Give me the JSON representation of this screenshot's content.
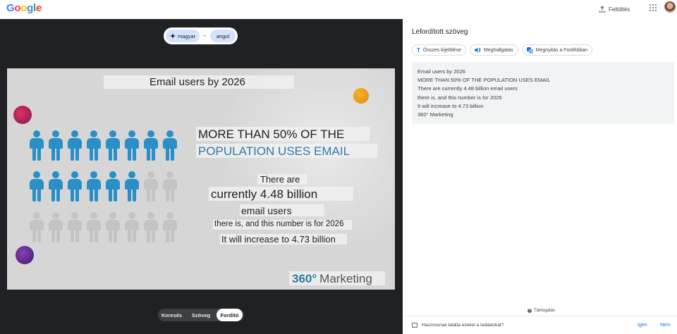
{
  "header": {
    "logo_letters": [
      {
        "char": "G",
        "color": "#4285F4"
      },
      {
        "char": "o",
        "color": "#EA4335"
      },
      {
        "char": "o",
        "color": "#FBBC05"
      },
      {
        "char": "g",
        "color": "#4285F4"
      },
      {
        "char": "l",
        "color": "#34A853"
      },
      {
        "char": "e",
        "color": "#EA4335"
      }
    ],
    "upload_label": "Feltöltés",
    "upload_icon": "upload-icon",
    "apps_icon": "apps-grid-icon"
  },
  "language_bar": {
    "source": "magyar",
    "target": "angol",
    "arrow": "→"
  },
  "image_overlays": {
    "title": "Email users by 2026",
    "headline_1": "MORE THAN 50% OF THE",
    "headline_2": "POPULATION USES EMAIL",
    "line_1": "There are",
    "line_2": "currently 4.48 billion",
    "line_3": "email users",
    "line_4": "there is, and this number is for 2026",
    "line_5": "It will increase to 4.73 billion",
    "brand_number": "360°",
    "brand_name": "Marketing"
  },
  "infographic": {
    "rows": 3,
    "columns": 8,
    "filled_count": 14,
    "filled_color": "#2a8fc7",
    "empty_color": "#c4c4c4"
  },
  "mode_switcher": {
    "items": [
      "Keresés",
      "Szöveg",
      "Fordító"
    ],
    "active": "Fordító"
  },
  "translation_panel": {
    "title": "Lefordított szöveg",
    "actions": [
      {
        "label": "Összes kijelölése",
        "icon": "select-text-icon"
      },
      {
        "label": "Meghallgatás",
        "icon": "speaker-icon"
      },
      {
        "label": "Megnyitás a Fordítóban",
        "icon": "translate-icon"
      }
    ],
    "result_lines": [
      "Email users by 2026",
      "MORE THAN 50% OF THE POPULATION USES EMAIL",
      "There are currently 4.48 billion email users",
      "there is, and this number is for 2026",
      "It will increase to 4.73 billion",
      "360° Marketing"
    ],
    "support_label": "Támogatás",
    "feedback_question": "Hasznosnak találta ezeket a találatokat?",
    "feedback_yes": "Igen",
    "feedback_no": "Nem"
  }
}
